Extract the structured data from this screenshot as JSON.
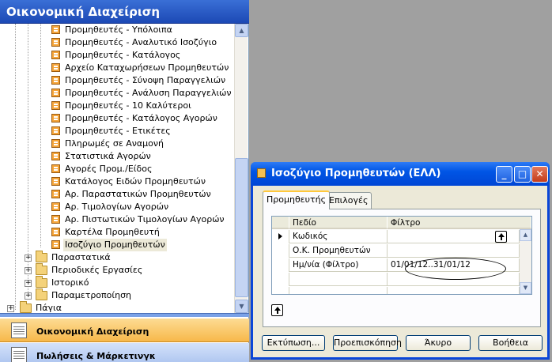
{
  "nav": {
    "title": "Οικονομική Διαχείριση",
    "report_items": [
      "Προμηθευτές - Υπόλοιπα",
      "Προμηθευτές - Αναλυτικό Ισοζύγιο",
      "Προμηθευτές - Κατάλογος",
      "Αρχείο Καταχωρήσεων Προμηθευτών",
      "Προμηθευτές - Σύνοψη Παραγγελιών",
      "Προμηθευτές - Ανάλυση Παραγγελιών",
      "Προμηθευτές - 10 Καλύτεροι",
      "Προμηθευτές - Κατάλογος Αγορών",
      "Προμηθευτές - Ετικέτες",
      "Πληρωμές σε Αναμονή",
      "Στατιστικά Αγορών",
      "Αγορές Προμ./Είδος",
      "Κατάλογος Ειδών Προμηθευτών",
      "Αρ. Παραστατικών Προμηθευτών",
      "Αρ. Τιμολογίων Αγορών",
      "Αρ. Πιστωτικών Τιμολογίων Αγορών",
      "Καρτέλα Προμηθευτή",
      "Ισοζύγιο Προμηθευτών"
    ],
    "folders": [
      "Παραστατικά",
      "Περιοδικές Εργασίες",
      "Ιστορικό",
      "Παραμετροποίηση"
    ],
    "root_folder": "Πάγια",
    "bottom_buttons": {
      "financial": "Οικονομική Διαχείριση",
      "sales": "Πωλήσεις & Μάρκετινγκ"
    }
  },
  "dialog": {
    "title": "Ισοζύγιο Προμηθευτών (ΕΛΛ)",
    "tabs": [
      "Προμηθευτής",
      "Επιλογές"
    ],
    "grid": {
      "headers": [
        "Πεδίο",
        "Φίλτρο"
      ],
      "rows": [
        {
          "field": "Κωδικός",
          "filter": ""
        },
        {
          "field": "Ο.Κ. Προμηθευτών",
          "filter": ""
        },
        {
          "field": "Ημ/νία (Φίλτρο)",
          "filter": "01/01/12..31/01/12"
        },
        {
          "field": "",
          "filter": ""
        },
        {
          "field": "",
          "filter": ""
        }
      ]
    },
    "buttons": {
      "print": "Εκτύπωση...",
      "preview": "Προεπισκόπηση",
      "cancel": "Άκυρο",
      "help": "Βοήθεια"
    }
  },
  "icons": {
    "report": "report-icon",
    "folder": "folder-icon",
    "expand": "plus-expander-icon",
    "lookup": "lookup-up-arrow-icon"
  },
  "colors": {
    "title_blue": "#1c49b5",
    "dialog_blue": "#0055e5",
    "nav_selected_orange": "#f7b84a",
    "desktop_gray": "#a0a0a0"
  }
}
